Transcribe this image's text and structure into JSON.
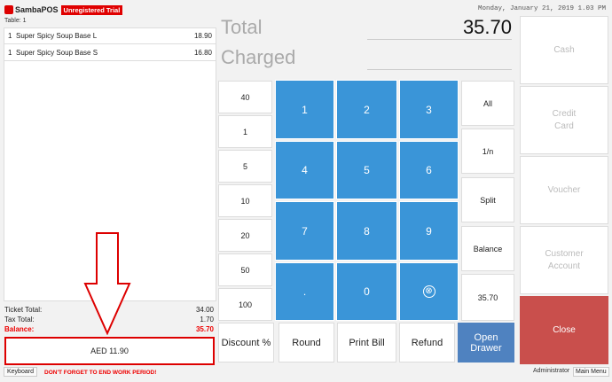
{
  "header": {
    "app_name": "SambaPOS",
    "trial_badge": "Unregistered Trial",
    "table_label": "Table: 1",
    "datetime": "Monday, January 21, 2019 1.03 PM"
  },
  "ticket": {
    "items": [
      {
        "qty": "1",
        "name": "Super Spicy Soup Base L",
        "price": "18.90"
      },
      {
        "qty": "1",
        "name": "Super Spicy Soup Base S",
        "price": "16.80"
      }
    ],
    "ticket_total_label": "Ticket Total:",
    "ticket_total_value": "34.00",
    "tax_total_label": "Tax Total:",
    "tax_total_value": "1.70",
    "balance_label": "Balance:",
    "balance_value": "35.70"
  },
  "payment": {
    "amount_text": "AED 11.90",
    "total_label": "Total",
    "charged_label": "Charged",
    "total_value": "35.70"
  },
  "quick_amounts": [
    "40",
    "1",
    "5",
    "10",
    "20",
    "50",
    "100"
  ],
  "numpad": [
    "1",
    "2",
    "3",
    "4",
    "5",
    "6",
    "7",
    "8",
    "9",
    ".",
    "0",
    "⊗"
  ],
  "split_buttons": [
    "All",
    "1/n",
    "Split",
    "Balance",
    "35.70"
  ],
  "payment_types": [
    "Cash",
    "Credit\nCard",
    "Voucher",
    "Customer\nAccount"
  ],
  "close_label": "Close",
  "bottom_buttons": {
    "discount": "Discount %",
    "round": "Round",
    "print_bill": "Print Bill",
    "refund": "Refund",
    "open_drawer": "Open Drawer"
  },
  "footer": {
    "keyboard": "Keyboard",
    "warning": "DON'T FORGET TO END WORK PERIOD!",
    "user": "Administrator",
    "main_menu": "Main Menu"
  },
  "colors": {
    "numpad_blue": "#3a95d8",
    "close_red": "#c94f4c",
    "open_drawer_blue": "#4f82c0",
    "accent_red": "#e00000"
  }
}
